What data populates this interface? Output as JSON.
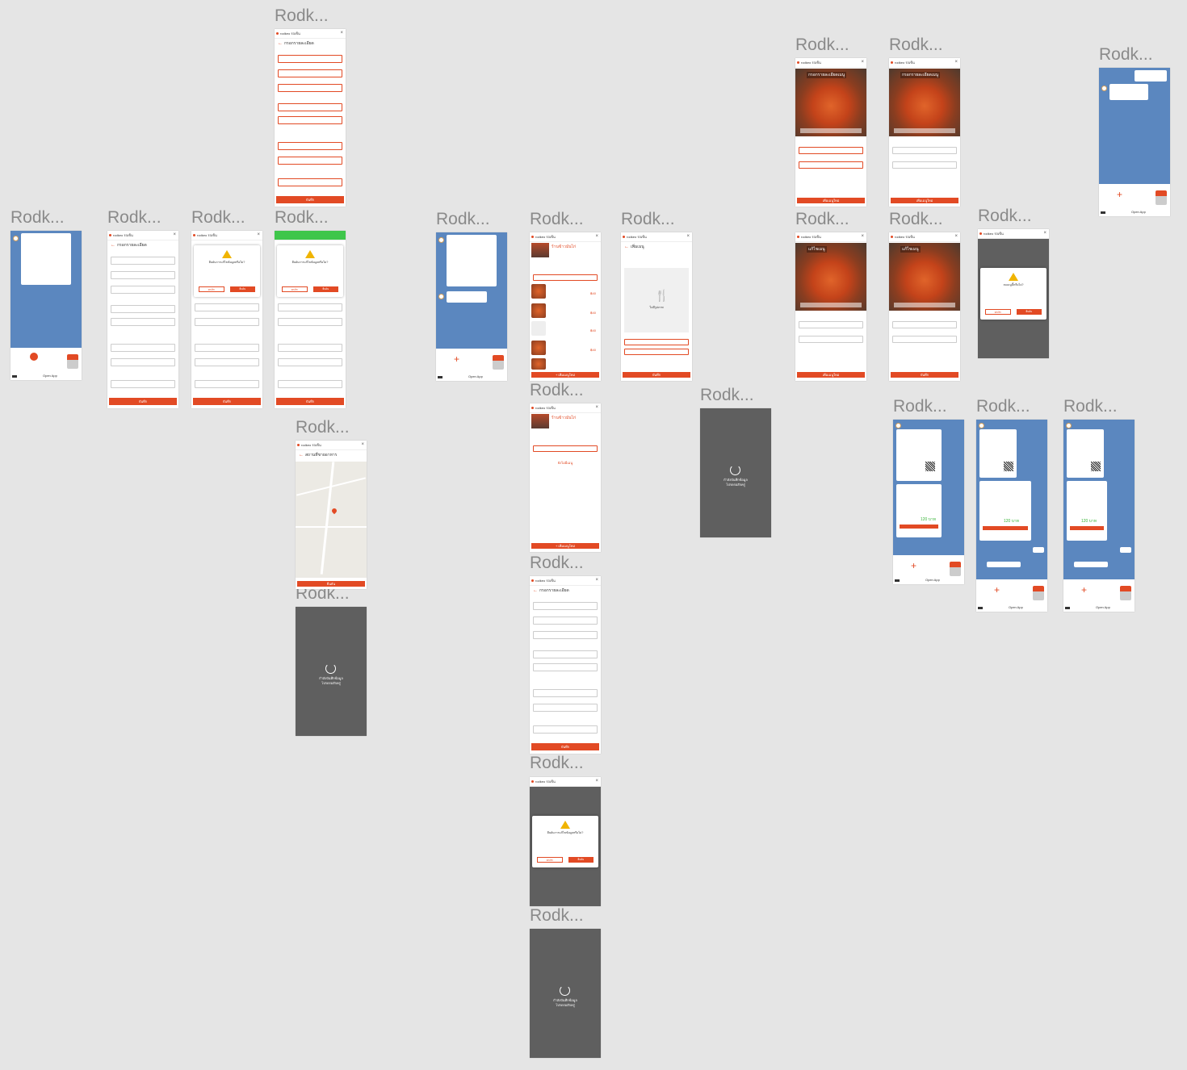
{
  "frame_label": "Rodk...",
  "app_title": "rodkeo รถเข็น",
  "open_app": "Open App",
  "screens": {
    "register_title": "กรอกรายละเอียด",
    "location_title": "สถานที่ขายอาหาร",
    "menu_title": "เพิ่มเมนู",
    "edit_menu_title": "แก้ไขเมนู",
    "fill_menu_title": "กรอกรายละเอียดเมนู",
    "restaurant_name": "ร้านข้าวมันไก่",
    "confirm_warning": "ยืนยันการแก้ไขข้อมูลหรือไม่?",
    "delete_warning": "ลบเมนูนี้หรือไม่?",
    "save": "บันทึก",
    "add_menu": "+ เพิ่มเมนูใหม่",
    "add_menu_short": "เพิ่มเมนูใหม่",
    "cancel": "ยกเลิก",
    "confirm": "ยืนยัน",
    "loading_saving": "กำลังบันทึกข้อมูล",
    "loading_wait": "โปรดรอสักครู่",
    "price": "฿40",
    "price_big": "120 บาท",
    "empty_menu": "ยังไม่มีเมนู",
    "open_hint": "เปิดร้านค้า",
    "no_image": "ไม่มีรูปภาพ"
  },
  "colors": {
    "accent": "#e24a24",
    "dark_frame": "#5f5f5f",
    "chat_bg": "#5b87bf",
    "success": "#3ec64a",
    "warning": "#f0b400"
  }
}
